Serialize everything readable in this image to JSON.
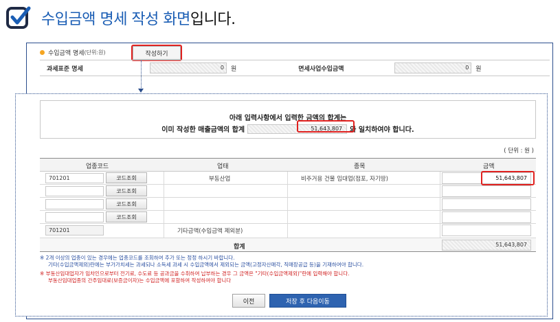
{
  "header": {
    "title_blue": "수입금액 명세 작성 화면",
    "title_black": "입니다."
  },
  "summary": {
    "label": "수입금액 명세",
    "unit": "(단위:원)",
    "write_button": "작성하기",
    "tax_std_label": "과세표준 명세",
    "tax_std_value": "0",
    "won1": "원",
    "exempt_label": "면세사업수입금액",
    "exempt_value": "0",
    "won2": "원"
  },
  "notice": {
    "line1": "아래 입력사항에서  입력한 금액의 합계는",
    "line2_before": "이미 작성한 매출금액의 합계",
    "line2_value": "51,643,807",
    "line2_after": "와 일치하여야 합니다."
  },
  "unit_label": "( 단위 : 원 )",
  "grid": {
    "headers": [
      "업종코드",
      "업태",
      "종목",
      "금액"
    ],
    "lookup_label": "코드조회",
    "rows": [
      {
        "code": "701201",
        "business": "부동산업",
        "item": "비주거용 건물 임대업(점포, 자기땅)",
        "amount": "51,643,807"
      },
      {
        "code": "",
        "business": "",
        "item": "",
        "amount": ""
      },
      {
        "code": "",
        "business": "",
        "item": "",
        "amount": ""
      },
      {
        "code": "",
        "business": "",
        "item": "",
        "amount": ""
      }
    ],
    "other_row": {
      "code": "701201",
      "label": "기타금액(수입금액 제외분)",
      "amount": ""
    },
    "total_label": "합계",
    "total_value": "51,643,807"
  },
  "notes": {
    "blue1": "※ 2개 이상의 업종이 있는 경우에는 업종코드를 조회하여 추가 또는 정정 하시기 바랍니다.",
    "blue2": "기타(수입금액제외)란에는 부가가치세는 과세되나 소득세 과세 시 수입금액에서 제외되는 금액(고정자산매각, 직매장공급 등)을 기재하여야 합니다.",
    "red1": "※ 부동산임대업자가 임차인으로부터 전기료, 수도료 등 공과금을 수취하여 납부하는 경우 그 금액은 \"기타(수입금액제외)\"란에 입력해야 합니다.",
    "red2": "부동산임대업종의 간주임대료(보증금이자)는 수입금액에 포함하여 작성하여야 합니다"
  },
  "buttons": {
    "prev": "이전",
    "next": "저장 후 다음이동"
  },
  "colors": {
    "accent_blue": "#1a5db4",
    "highlight_red": "#e0201e",
    "button_blue": "#2e63b0"
  }
}
